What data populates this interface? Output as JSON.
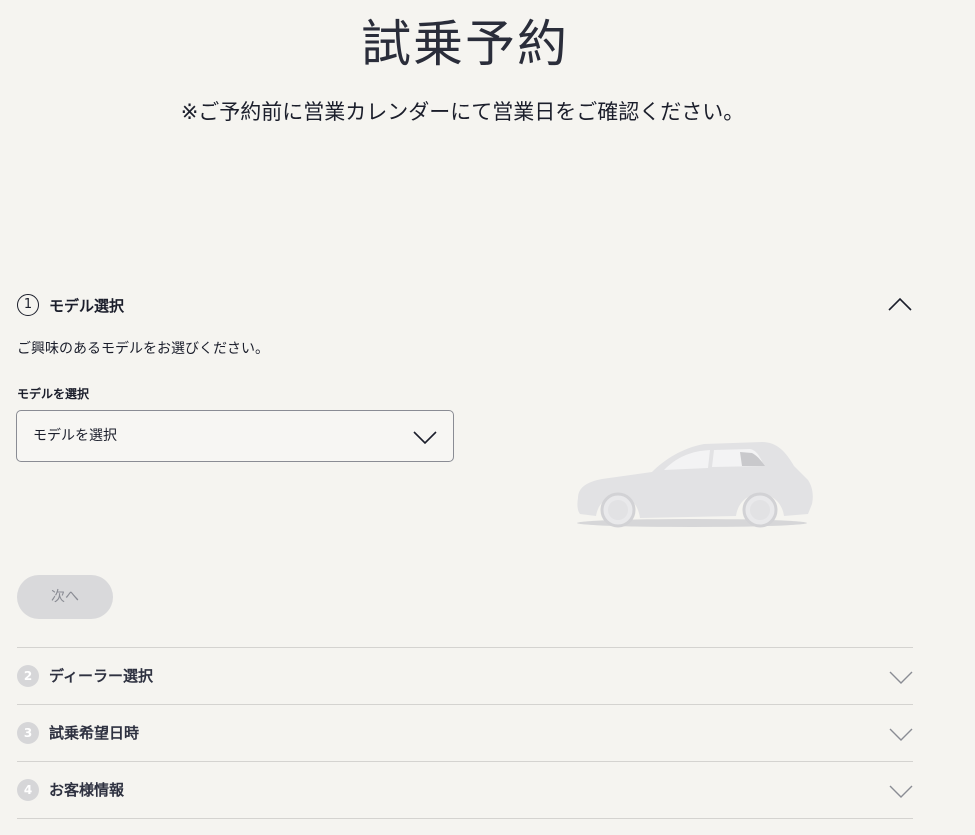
{
  "page": {
    "title": "試乗予約",
    "notice": "※ご予約前に営業カレンダーにて営業日をご確認ください。"
  },
  "steps": [
    {
      "number": "1",
      "title": "モデル選択",
      "expanded": true,
      "lead": "ご興味のあるモデルをお選びください。",
      "field_label": "モデルを選択",
      "select_value": "モデルを選択",
      "next_label": "次へ",
      "next_enabled": false
    },
    {
      "number": "2",
      "title": "ディーラー選択",
      "expanded": false
    },
    {
      "number": "3",
      "title": "試乗希望日時",
      "expanded": false
    },
    {
      "number": "4",
      "title": "お客様情報",
      "expanded": false
    }
  ],
  "icons": {
    "collapse": "chevron-up-icon",
    "expand": "chevron-down-icon",
    "select": "chevron-down-icon",
    "car": "car-silhouette-icon"
  },
  "colors": {
    "background": "#f5f4f0",
    "text": "#1b1e2b",
    "disabled_button": "#d9d9db",
    "step_badge": "#d6d6d8",
    "divider": "#d4d3d0"
  }
}
